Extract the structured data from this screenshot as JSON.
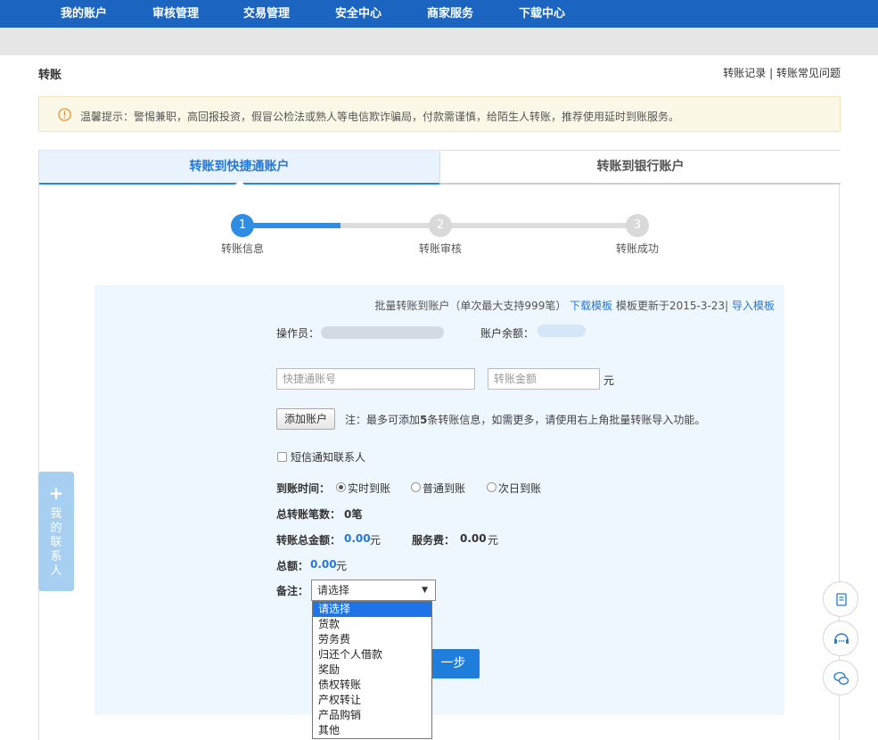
{
  "nav": {
    "items": [
      "我的账户",
      "审核管理",
      "交易管理",
      "安全中心",
      "商家服务",
      "下载中心"
    ]
  },
  "page": {
    "title": "转账",
    "link_records": "转账记录",
    "link_separator": " | ",
    "link_faq": "转账常见问题"
  },
  "notice": {
    "icon": "warning-icon",
    "text": "温馨提示：警惕兼职，高回报投资，假冒公检法或熟人等电信欺诈骗局，付款需谨慎，给陌生人转账，推荐使用延时到账服务。"
  },
  "tabs": {
    "active": "转账到快捷通账户",
    "inactive": "转账到银行账户"
  },
  "steps": [
    {
      "num": "1",
      "label": "转账信息",
      "active": true
    },
    {
      "num": "2",
      "label": "转账审核",
      "active": false
    },
    {
      "num": "3",
      "label": "转账成功",
      "active": false
    }
  ],
  "batch": {
    "text": "批量转账到账户（单次最大支持999笔）",
    "download": "下载模板",
    "updated": "模板更新于2015-3-23|",
    "import": "导入模板"
  },
  "form": {
    "operator_label": "操作员：",
    "balance_label": "账户余额：",
    "account_placeholder": "快捷通账号",
    "amount_placeholder": "转账金额",
    "amount_unit": "元",
    "add_button": "添加账户",
    "add_note_prefix": "注：最多可添加",
    "add_note_num": "5",
    "add_note_suffix": "条转账信息，如需更多，请使用右上角批量转账导入功能。",
    "sms_label": "短信通知联系人",
    "time_label": "到账时间：",
    "time_options": [
      "实时到账",
      "普通到账",
      "次日到账"
    ],
    "time_selected": 0,
    "count_label": "总转账笔数：",
    "count_value": "0笔",
    "total_amount_label": "转账总金额：",
    "total_amount_value": "0.00",
    "total_amount_unit": "元",
    "fee_label": "服务费：",
    "fee_value": "0.00",
    "fee_unit": "元",
    "grand_label": "总额：",
    "grand_value": "0.00",
    "grand_unit": "元",
    "remark_label": "备注：",
    "remark_selected": "请选择",
    "remark_options": [
      "请选择",
      "货款",
      "劳务费",
      "归还个人借款",
      "奖励",
      "债权转账",
      "产权转让",
      "产品购销",
      "其他"
    ],
    "next_button": "一步"
  },
  "side": {
    "contact_plus": "+",
    "contact_text": "我的联系人"
  },
  "float_icons": [
    "note-icon",
    "customer-service-icon",
    "chat-icon"
  ],
  "colors": {
    "nav_blue": "#1b65c0",
    "accent_blue": "#2478d6",
    "step_active": "#2f8de4",
    "notice_bg": "#fcf8e8"
  }
}
